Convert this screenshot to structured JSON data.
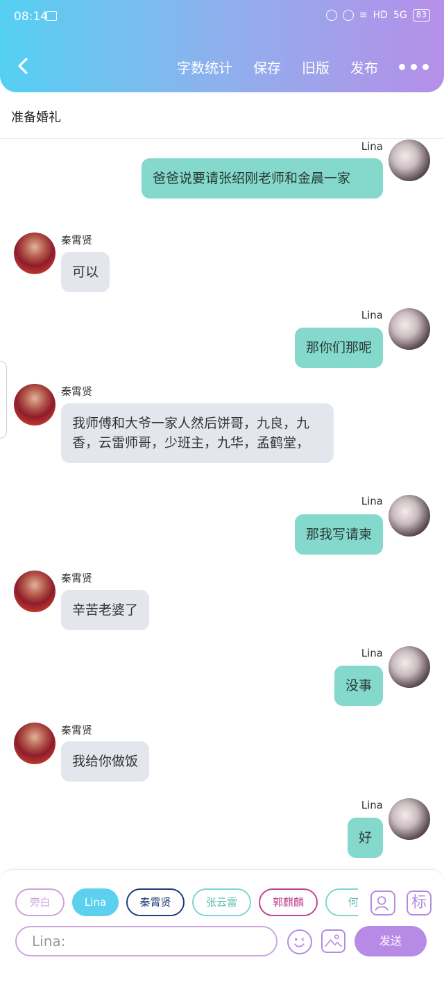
{
  "status": {
    "time": "08:14",
    "network": "HD",
    "signal": "5G",
    "battery": "83"
  },
  "toolbar": {
    "word_count_label": "字数统计",
    "save_label": "保存",
    "old_version_label": "旧版",
    "publish_label": "发布"
  },
  "title": "准备婚礼",
  "messages": [
    {
      "sender": "Lina",
      "text": "爸爸说要请张绍刚老师和金晨一家"
    },
    {
      "sender": "秦霄贤",
      "text": "可以"
    },
    {
      "sender": "Lina",
      "text": "那你们那呢"
    },
    {
      "sender": "秦霄贤",
      "text": "我师傅和大爷一家人然后饼哥，九良，九香，云雷师哥，少班主，九华，孟鹤堂，"
    },
    {
      "sender": "Lina",
      "text": "那我写请柬"
    },
    {
      "sender": "秦霄贤",
      "text": "辛苦老婆了"
    },
    {
      "sender": "Lina",
      "text": "没事"
    },
    {
      "sender": "秦霄贤",
      "text": "我给你做饭"
    },
    {
      "sender": "Lina",
      "text": "好"
    }
  ],
  "composer": {
    "roles": [
      "旁白",
      "Lina",
      "秦霄贤",
      "张云雷",
      "郭麒麟",
      "何"
    ],
    "tag_label": "标",
    "input_value": "Lina:",
    "send_label": "发送"
  },
  "colors": {
    "header_start": "#54d0f2",
    "header_end": "#b58fe8",
    "bubble_right": "#84d8cc",
    "bubble_left": "#e3e7ed",
    "accent": "#b78ae6"
  }
}
